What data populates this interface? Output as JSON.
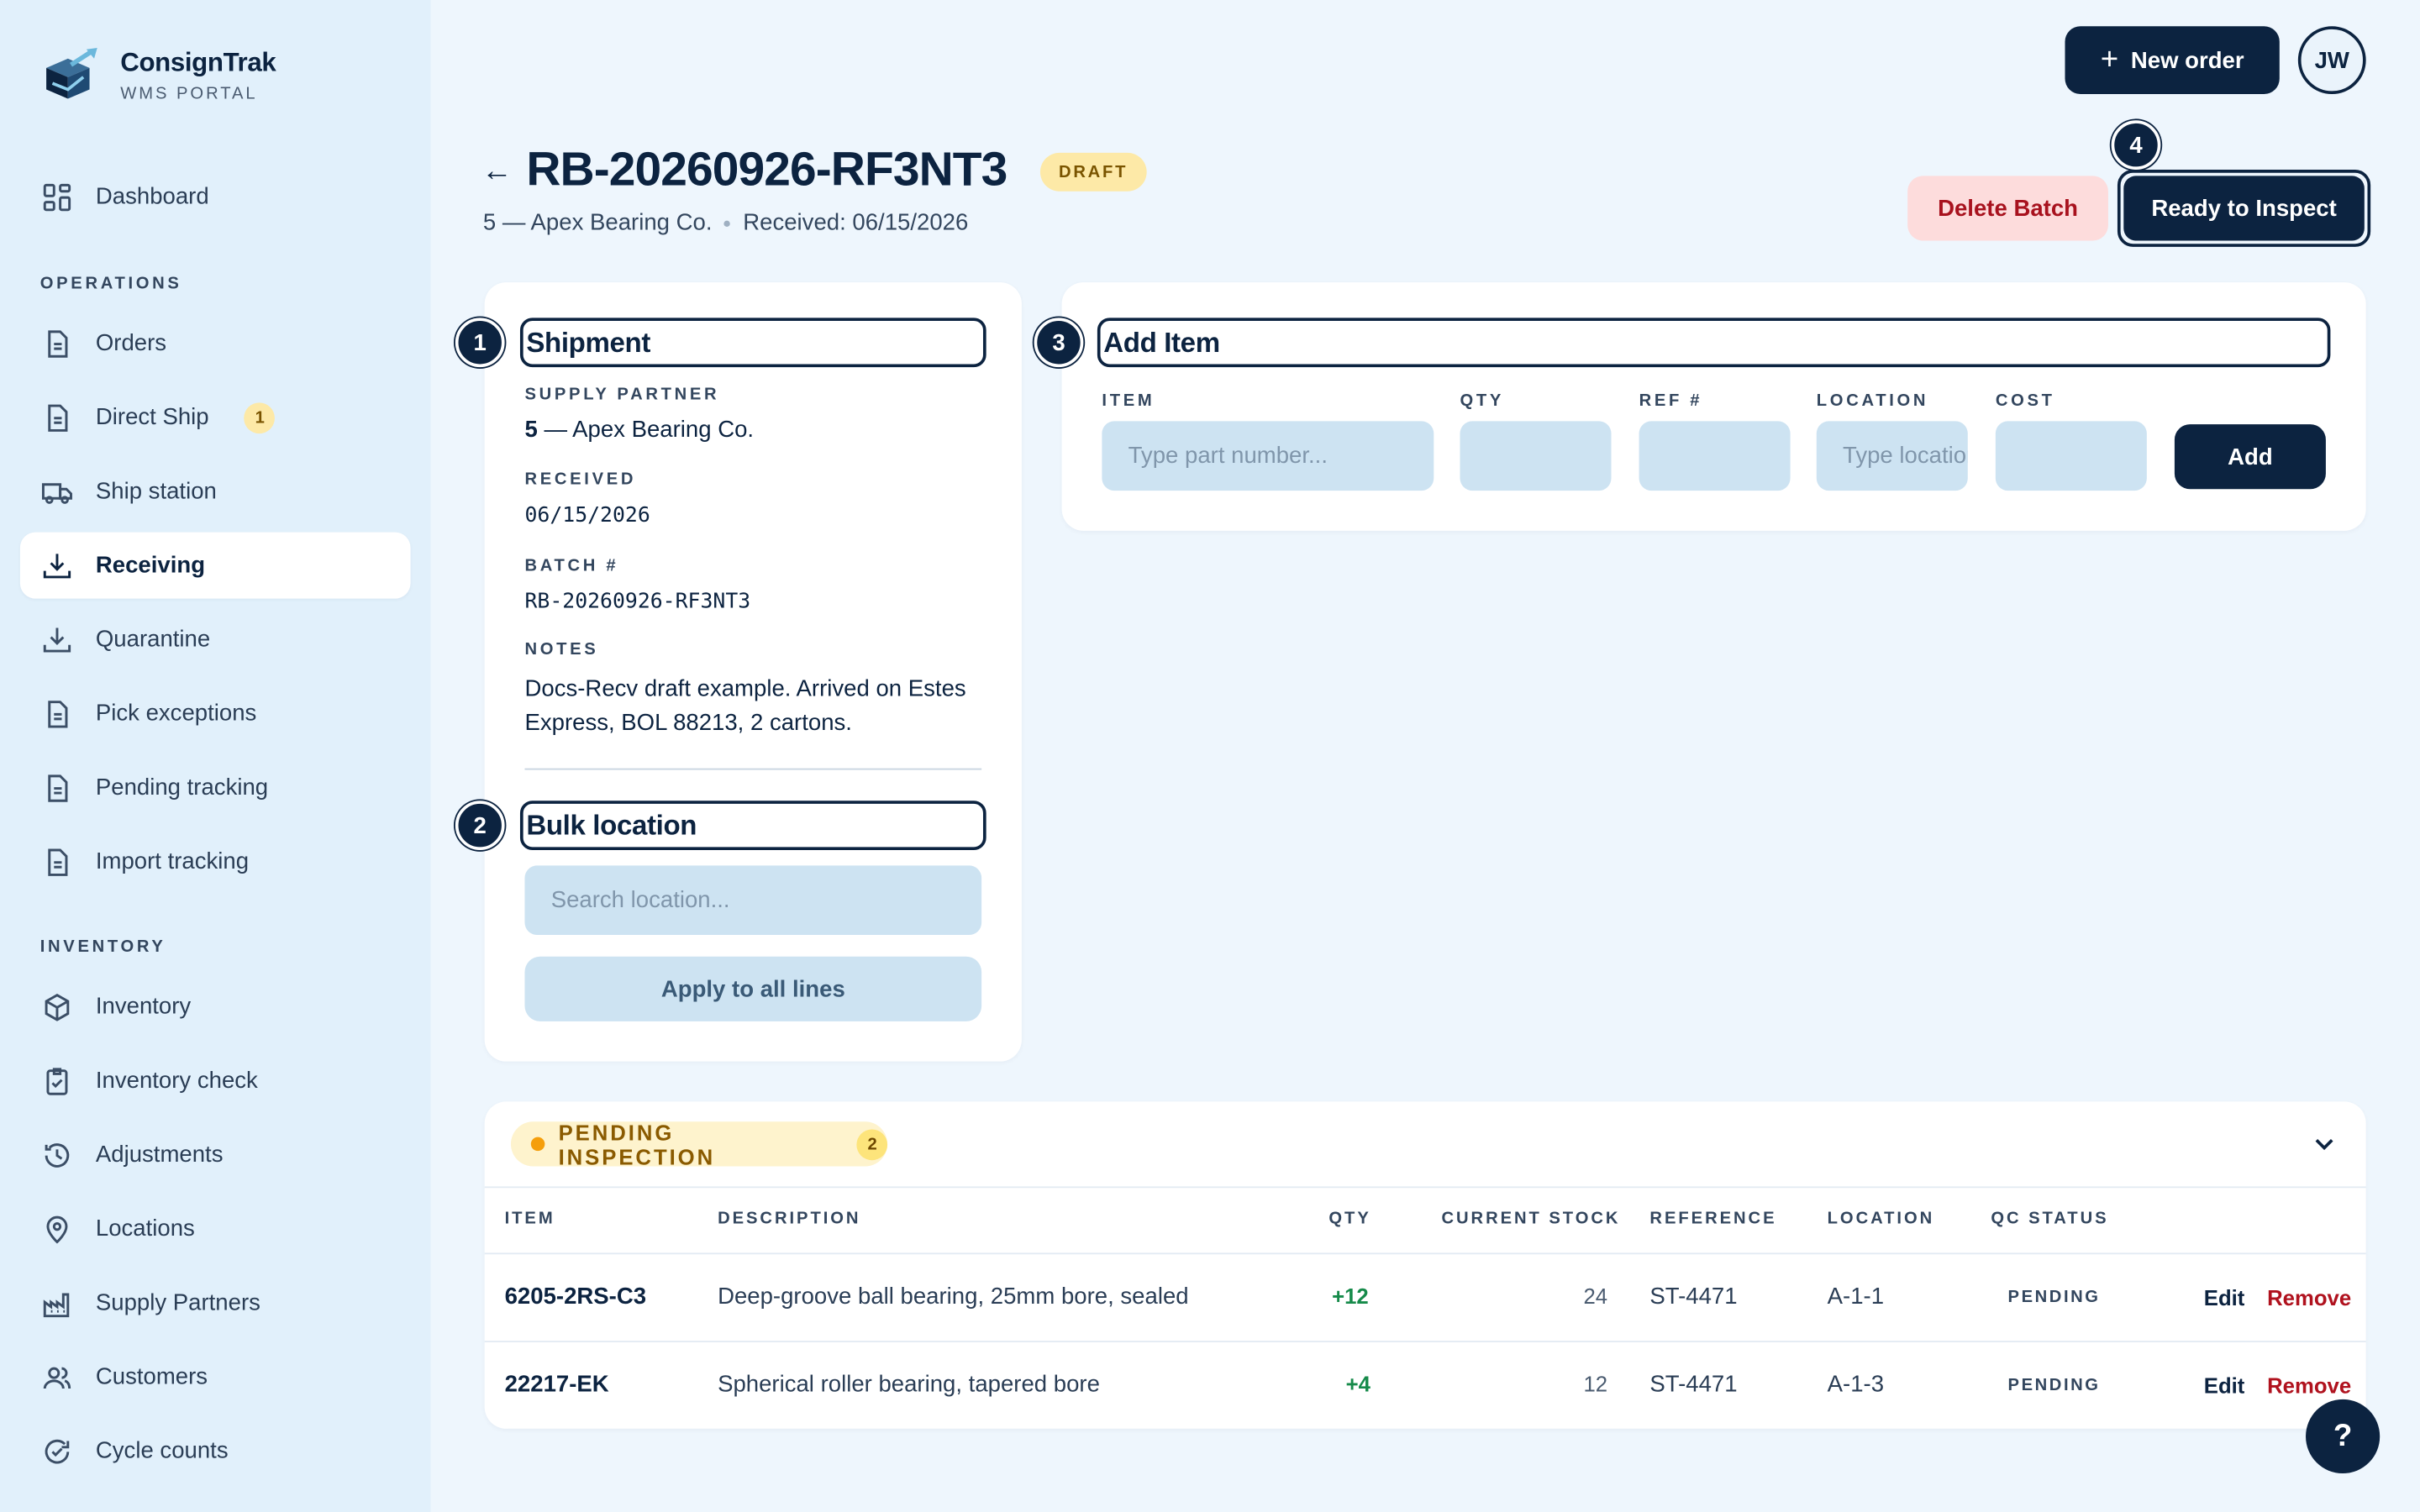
{
  "brand": {
    "name": "ConsignTrak",
    "subtitle": "WMS PORTAL"
  },
  "sidebar": {
    "top_items": [
      {
        "label": "Dashboard",
        "icon": "grid-icon"
      }
    ],
    "operations_label": "OPERATIONS",
    "operations": [
      {
        "label": "Orders",
        "icon": "document-icon"
      },
      {
        "label": "Direct Ship",
        "icon": "document-icon",
        "badge": "1"
      },
      {
        "label": "Ship station",
        "icon": "truck-icon"
      },
      {
        "label": "Receiving",
        "icon": "download-icon",
        "active": true
      },
      {
        "label": "Quarantine",
        "icon": "download-icon"
      },
      {
        "label": "Pick exceptions",
        "icon": "document-icon"
      },
      {
        "label": "Pending tracking",
        "icon": "document-icon"
      },
      {
        "label": "Import tracking",
        "icon": "document-icon"
      }
    ],
    "inventory_label": "INVENTORY",
    "inventory": [
      {
        "label": "Inventory",
        "icon": "box-icon"
      },
      {
        "label": "Inventory check",
        "icon": "clipboard-check-icon"
      },
      {
        "label": "Adjustments",
        "icon": "history-icon"
      },
      {
        "label": "Locations",
        "icon": "map-pin-icon"
      },
      {
        "label": "Supply Partners",
        "icon": "factory-icon"
      },
      {
        "label": "Customers",
        "icon": "users-icon"
      },
      {
        "label": "Cycle counts",
        "icon": "refresh-check-icon"
      }
    ]
  },
  "topbar": {
    "new_order_label": "New order",
    "avatar_initials": "JW"
  },
  "header": {
    "title": "RB-20260926-RF3NT3",
    "status_badge": "DRAFT",
    "partner": "5 — Apex Bearing Co.",
    "received": "Received: 06/15/2026",
    "delete_label": "Delete Batch",
    "ready_label": "Ready to Inspect"
  },
  "steps": [
    "1",
    "2",
    "3",
    "4"
  ],
  "shipment": {
    "heading": "Shipment",
    "supply_partner_label": "SUPPLY PARTNER",
    "supply_partner_id": "5",
    "supply_partner_name": " — Apex Bearing Co.",
    "received_label": "RECEIVED",
    "received_value": "06/15/2026",
    "batch_label": "BATCH #",
    "batch_value": "RB-20260926-RF3NT3",
    "notes_label": "NOTES",
    "notes_line1": "Docs-Recv draft example. Arrived on Estes",
    "notes_line2": "Express, BOL 88213, 2 cartons."
  },
  "bulk_location": {
    "heading": "Bulk location",
    "search_placeholder": "Search location...",
    "apply_label": "Apply to all lines"
  },
  "add_item": {
    "heading": "Add Item",
    "item_label": "ITEM",
    "item_placeholder": "Type part number...",
    "qty_label": "QTY",
    "ref_label": "REF #",
    "location_label": "LOCATION",
    "location_placeholder": "Type location",
    "cost_label": "COST",
    "add_label": "Add"
  },
  "pending": {
    "label": "PENDING INSPECTION",
    "count": "2",
    "columns": [
      "ITEM",
      "DESCRIPTION",
      "QTY",
      "CURRENT STOCK",
      "REFERENCE",
      "LOCATION",
      "QC STATUS"
    ],
    "rows": [
      {
        "item": "6205-2RS-C3",
        "description": "Deep-groove ball bearing, 25mm bore, sealed",
        "qty": "+12",
        "stock": "24",
        "reference": "ST-4471",
        "location": "A-1-1",
        "qc": "PENDING",
        "edit": "Edit",
        "remove": "Remove"
      },
      {
        "item": "22217-EK",
        "description": "Spherical roller bearing, tapered bore",
        "qty": "+4",
        "stock": "12",
        "reference": "ST-4471",
        "location": "A-1-3",
        "qc": "PENDING",
        "edit": "Edit",
        "remove": "Remove"
      }
    ]
  },
  "help_label": "?"
}
